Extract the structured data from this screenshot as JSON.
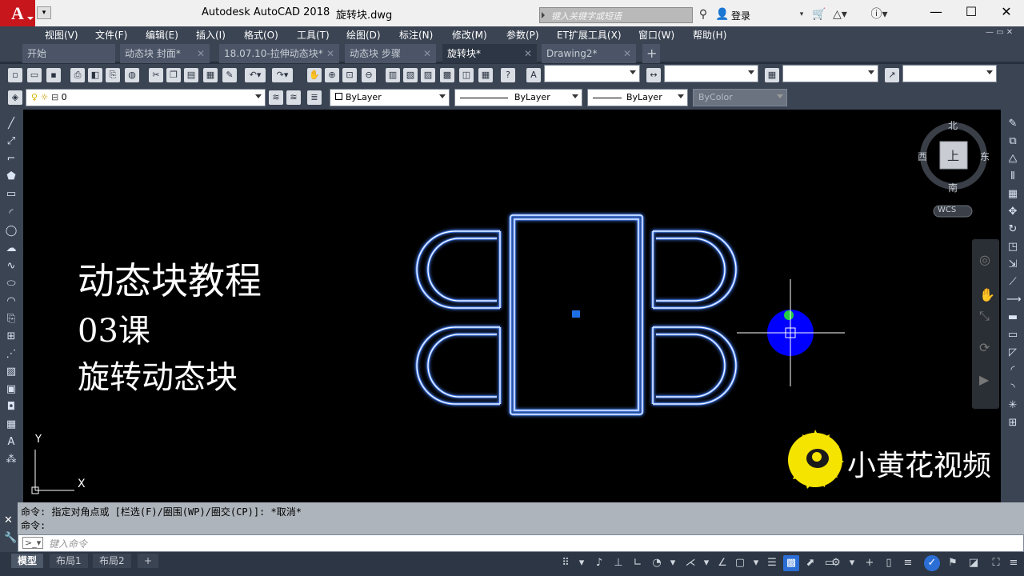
{
  "titlebar": {
    "app_title": "Autodesk AutoCAD 2018",
    "file_title": "旋转块.dwg",
    "search_placeholder": "键入关键字或短语",
    "login_label": "登录"
  },
  "menu": [
    "视图(V)",
    "文件(F)",
    "编辑(E)",
    "插入(I)",
    "格式(O)",
    "工具(T)",
    "绘图(D)",
    "标注(N)",
    "修改(M)",
    "参数(P)",
    "ET扩展工具(X)",
    "窗口(W)",
    "帮助(H)"
  ],
  "tabs": [
    {
      "label": "开始",
      "closable": false,
      "active": false
    },
    {
      "label": "动态块 封面*",
      "closable": true,
      "active": false
    },
    {
      "label": "18.07.10-拉伸动态块*",
      "closable": true,
      "active": false
    },
    {
      "label": "动态块 步骤",
      "closable": true,
      "active": false
    },
    {
      "label": "旋转块*",
      "closable": true,
      "active": true
    },
    {
      "label": "Drawing2*",
      "closable": true,
      "active": false
    }
  ],
  "properties": {
    "layer": "0",
    "color": "ByLayer",
    "linetype": "ByLayer",
    "lineweight": "ByLayer",
    "plotstyle": "ByColor"
  },
  "viewcube": {
    "north": "北",
    "south": "南",
    "east": "东",
    "west": "西",
    "top": "上",
    "wcs": "WCS"
  },
  "overlay": {
    "line1": "动态块教程",
    "line2": "03课",
    "line3": "旋转动态块",
    "watermark": "小黄花视频"
  },
  "ucs": {
    "x": "X",
    "y": "Y"
  },
  "command": {
    "history1": "命令: 指定对角点或 [栏选(F)/圈围(WP)/圈交(CP)]: *取消*",
    "history2": "命令:",
    "input_placeholder": "键入命令"
  },
  "layout_tabs": [
    "模型",
    "布局1",
    "布局2"
  ],
  "colors": {
    "accent_blue": "#0000ff",
    "grip_green": "#22cc44",
    "drawing_outline": "#ffffff",
    "drawing_glow": "#3a7cff",
    "sunflower": "#f5e400"
  }
}
